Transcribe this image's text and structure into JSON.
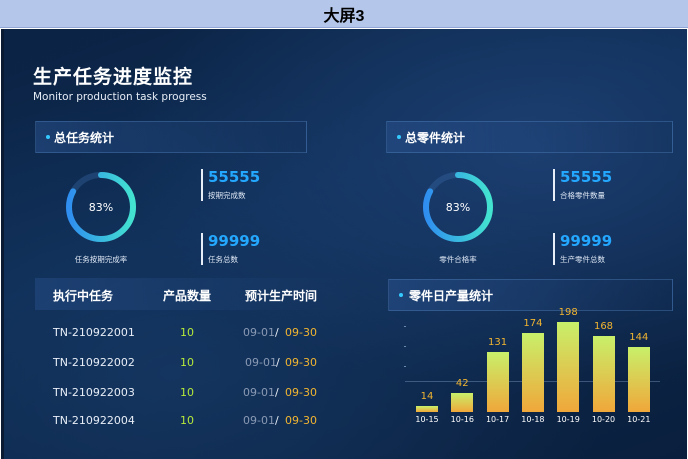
{
  "window": {
    "title": "大屏3"
  },
  "header": {
    "title": "生产任务进度监控",
    "subtitle": "Monitor production task progress"
  },
  "task_panel": {
    "title": "总任务统计",
    "ring_value": "83%",
    "ring_fraction": 0.83,
    "ring_label": "任务按期完成率",
    "stat1": {
      "value": "55555",
      "label": "按期完成数"
    },
    "stat2": {
      "value": "99999",
      "label": "任务总数"
    }
  },
  "parts_panel": {
    "title": "总零件统计",
    "ring_value": "83%",
    "ring_fraction": 0.83,
    "ring_label": "零件合格率",
    "stat1": {
      "value": "55555",
      "label": "合格零件数量"
    },
    "stat2": {
      "value": "99999",
      "label": "生产零件总数"
    }
  },
  "table": {
    "headers": [
      "执行中任务",
      "产品数量",
      "预计生产时间"
    ],
    "rows": [
      {
        "task": "TN-210922001",
        "qty": "10",
        "start": "09-01",
        "sep": "/",
        "end": "09-30"
      },
      {
        "task": "TN-210922002",
        "qty": "10",
        "start": "09-01",
        "sep": "/",
        "end": "09-30"
      },
      {
        "task": "TN-210922003",
        "qty": "10",
        "start": "09-01",
        "sep": "/",
        "end": "09-30"
      },
      {
        "task": "TN-210922004",
        "qty": "10",
        "start": "09-01",
        "sep": "/",
        "end": "09-30"
      }
    ]
  },
  "chart_panel": {
    "title": "零件日产量统计"
  },
  "chart_data": {
    "type": "bar",
    "categories": [
      "10-15",
      "10-16",
      "10-17",
      "10-18",
      "10-19",
      "10-20",
      "10-21"
    ],
    "values": [
      14,
      42,
      131,
      174,
      198,
      168,
      144
    ],
    "ylim": [
      0,
      220
    ],
    "grid": false,
    "colors": {
      "top": "#c8f06a",
      "bottom": "#f0a73a",
      "label": "#f2b530"
    }
  },
  "colors": {
    "accent": "#24a8ff",
    "ring_start": "#2f8ef0",
    "ring_end": "#43e3d0",
    "qty": "#b6ea3a",
    "end_date": "#f2b530"
  }
}
